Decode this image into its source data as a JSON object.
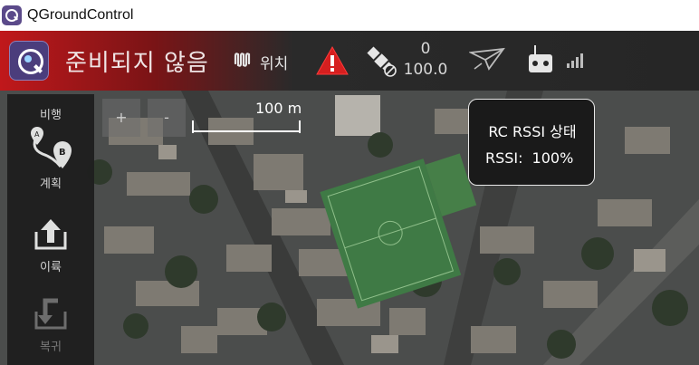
{
  "window": {
    "title": "QGroundControl"
  },
  "toolbar": {
    "status": "준비되지 않음",
    "position_label": "위치",
    "satellite_count": "0",
    "hdop": "100.0"
  },
  "tools": [
    {
      "label": "비행"
    },
    {
      "label": "계획"
    },
    {
      "label": "이륙"
    },
    {
      "label": "복귀"
    }
  ],
  "map": {
    "zoom_in": "+",
    "zoom_out": "-",
    "scale": "100 m"
  },
  "rssi_popup": {
    "title": "RC RSSI 상태",
    "label": "RSSI:",
    "value": "100%"
  },
  "colors": {
    "toolbar_alert_red": "#c0181b",
    "toolbar_dark": "#262626",
    "field_green": "#3f7a45",
    "app_purple": "#4b3d7c"
  }
}
